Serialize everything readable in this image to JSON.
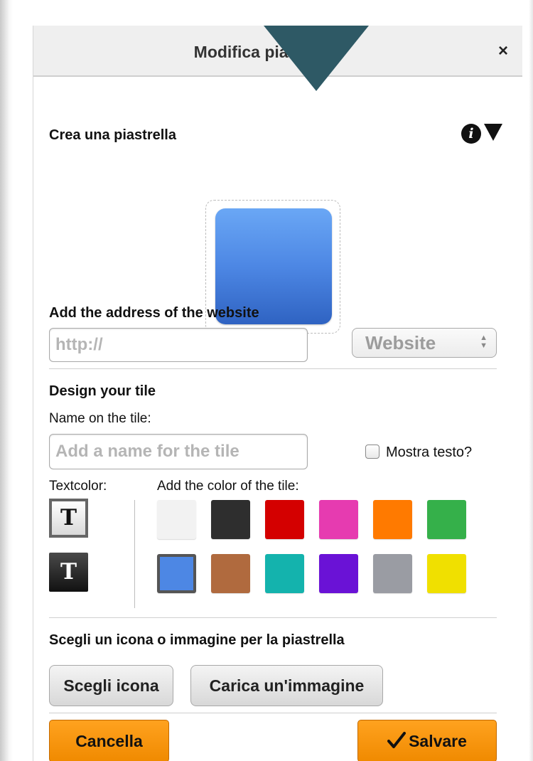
{
  "dialog": {
    "title": "Modifica piastrella",
    "close_icon": "close-icon",
    "close_glyph": "×"
  },
  "create_section": {
    "heading": "Crea una piastrella",
    "info_icon": "info-icon",
    "info_glyph": "i",
    "collapse_icon": "triangle-down-icon"
  },
  "preview": {
    "tile_color": "#4d87e4"
  },
  "website": {
    "heading": "Add the address of the website",
    "url_value": "",
    "url_placeholder": "http://",
    "type_select": "Website"
  },
  "design": {
    "heading": "Design your tile",
    "name_label": "Name on the tile:",
    "name_value": "",
    "name_placeholder": "Add a name for the tile",
    "show_text_label": "Mostra testo?",
    "show_text_checked": false,
    "textcolor_label": "Textcolor:",
    "tile_color_label": "Add the color of the tile:",
    "textcolor_options": [
      {
        "glyph": "T",
        "color": "#ffffff",
        "selected": true
      },
      {
        "glyph": "T",
        "color": "#222222",
        "selected": false
      }
    ],
    "tile_colors": [
      {
        "color": "#f2f2f2",
        "selected": false
      },
      {
        "color": "#2e2e2e",
        "selected": false
      },
      {
        "color": "#d40000",
        "selected": false
      },
      {
        "color": "#e63bb0",
        "selected": false
      },
      {
        "color": "#ff7a00",
        "selected": false
      },
      {
        "color": "#35b04a",
        "selected": false
      },
      {
        "color": "#4d87e4",
        "selected": true
      },
      {
        "color": "#b06a3e",
        "selected": false
      },
      {
        "color": "#14b3ad",
        "selected": false
      },
      {
        "color": "#6a12d6",
        "selected": false
      },
      {
        "color": "#9a9ca3",
        "selected": false
      },
      {
        "color": "#f0e000",
        "selected": false
      }
    ]
  },
  "icon_section": {
    "heading": "Scegli un icona o immagine per la piastrella",
    "choose_icon_button": "Scegli icona",
    "upload_image_button": "Carica un'immagine"
  },
  "footer": {
    "cancel_button": "Cancella",
    "save_button": "Salvare",
    "save_icon": "checkmark-icon"
  }
}
